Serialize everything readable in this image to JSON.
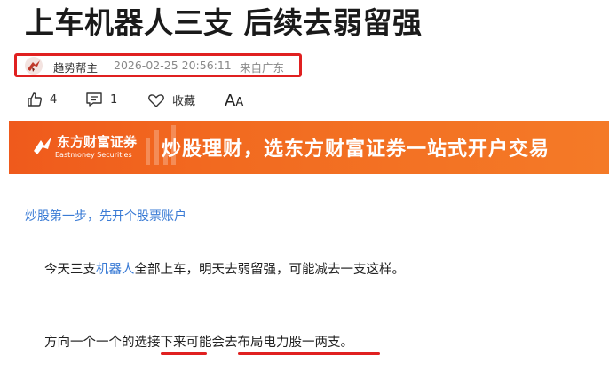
{
  "article": {
    "title": "上车机器人三支 后续去弱留强",
    "author": "趋势帮主",
    "timestamp": "2026-02-25 20:56:11",
    "source": "来自广东"
  },
  "actions": {
    "like_count": "4",
    "comment_count": "1",
    "favorite_label": "收藏",
    "font_label_big": "A",
    "font_label_small": "A"
  },
  "banner": {
    "brand_cn": "东方财富证券",
    "brand_en": "Eastmoney Securities",
    "slogan": "炒股理财，选东方财富证券一站式开户交易"
  },
  "promo_link": "炒股第一步，先开个股票账户",
  "paragraphs": {
    "p1_before": "今天三支",
    "p1_keyword": "机器人",
    "p1_after": "全部上车，明天去弱留强，可能减去一支这样。",
    "p2": "方向一个一个的选接下来可能会去布局电力股一两支。"
  },
  "colors": {
    "highlight_border": "#e02020",
    "link_blue": "#3a7bd5",
    "banner_orange": "#f26a20"
  }
}
